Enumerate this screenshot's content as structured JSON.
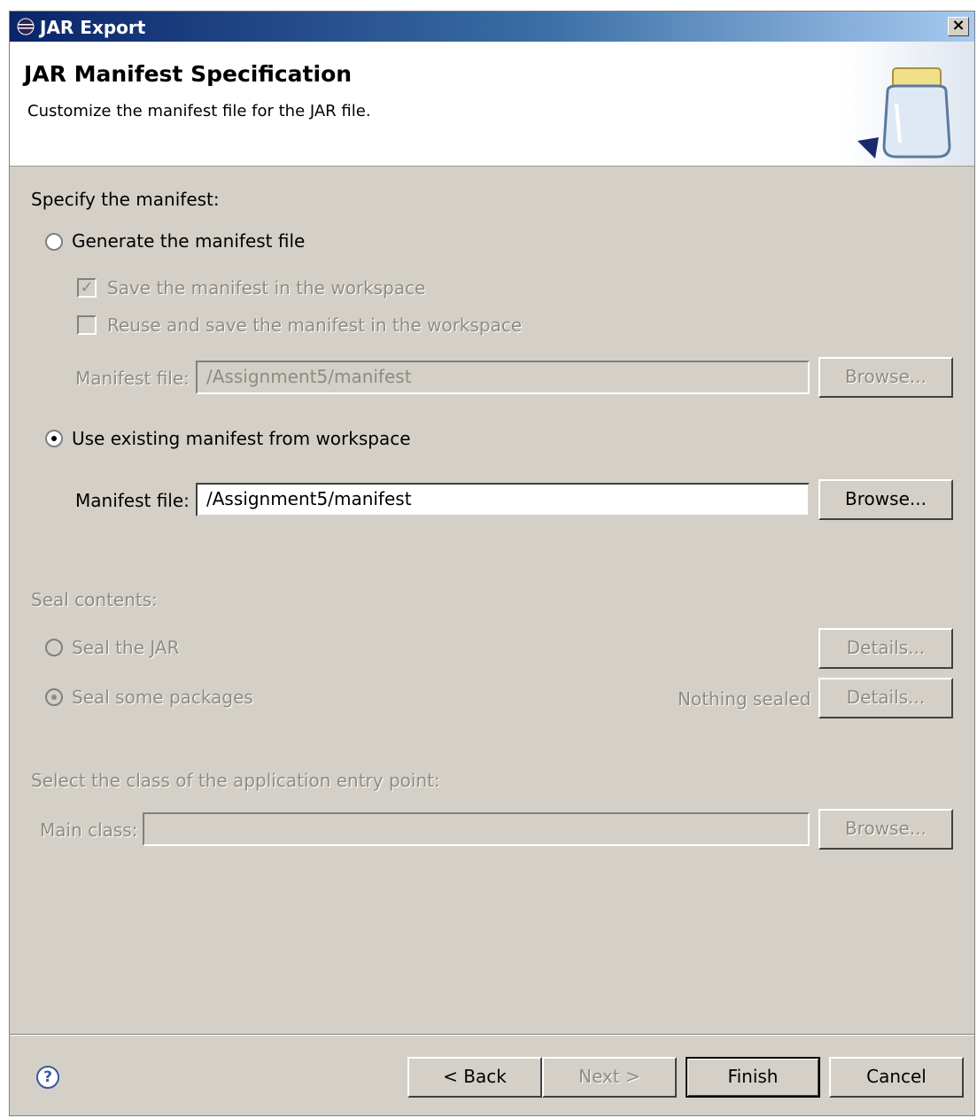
{
  "window": {
    "title": "JAR Export",
    "close_label": "×"
  },
  "header": {
    "title": "JAR Manifest Specification",
    "description": "Customize the manifest file for the JAR file."
  },
  "manifest": {
    "section_label": "Specify the manifest:",
    "generate_label": "Generate the manifest file",
    "save_label": "Save the manifest in the workspace",
    "reuse_label": "Reuse and save the manifest in the workspace",
    "gen_file_label": "Manifest file:",
    "gen_file_value": "/Assignment5/manifest",
    "gen_browse": "Browse...",
    "existing_label": "Use existing manifest from workspace",
    "existing_file_label": "Manifest file:",
    "existing_file_value": "/Assignment5/manifest",
    "existing_browse": "Browse..."
  },
  "seal": {
    "section_label": "Seal contents:",
    "seal_jar_label": "Seal the JAR",
    "seal_jar_details": "Details...",
    "seal_some_label": "Seal some packages",
    "status": "Nothing sealed",
    "seal_some_details": "Details..."
  },
  "entry": {
    "section_label": "Select the class of the application entry point:",
    "main_class_label": "Main class:",
    "main_class_value": "",
    "browse": "Browse..."
  },
  "footer": {
    "help_glyph": "?",
    "back": "< Back",
    "next": "Next >",
    "finish": "Finish",
    "cancel": "Cancel"
  }
}
